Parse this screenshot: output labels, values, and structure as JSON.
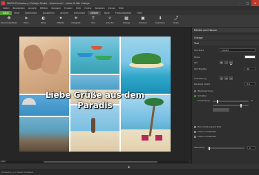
{
  "window": {
    "title": "MAGIX Photostory / Collage Studio - Unbenannt* - Liebe Grüße Collage"
  },
  "menu": [
    "Datei",
    "Bearbeiten",
    "Ansicht",
    "Effekte",
    "Vorlagen",
    "Fenster",
    "Hilfe",
    "Online",
    "Aktionen",
    "Extras",
    "Hilfe"
  ],
  "tabs": [
    "Datei",
    "Start",
    "Bearbeiten",
    "Auswählen",
    "Ansicht",
    "Hilfsmittel",
    "Effekte",
    "Texte",
    "Produktpalette",
    "Hilfe"
  ],
  "toolbar": [
    {
      "label": "Verschiebe/Photo",
      "icon": "move-icon"
    },
    {
      "label": "Maus",
      "icon": "cursor-icon"
    },
    {
      "label": "Farbe",
      "icon": "color-icon"
    },
    {
      "label": "Effekte",
      "icon": "effects-icon"
    },
    {
      "label": "Helligkeit",
      "icon": "brightness-icon"
    },
    {
      "label": "Text",
      "icon": "text-icon"
    },
    {
      "label": "Auto Fix",
      "icon": "autofix-icon"
    },
    {
      "label": "Collage",
      "icon": "collage-icon"
    },
    {
      "label": "Rahmen",
      "icon": "frame-icon"
    },
    {
      "label": "Speichern",
      "icon": "save-icon"
    },
    {
      "label": "Teilen",
      "icon": "share-icon"
    }
  ],
  "collage": {
    "line1": "Liebe Grüße aus dem",
    "line2": "Paradis"
  },
  "panel": {
    "header": "Effekte und Ebenen",
    "section1": "Collage",
    "section2": "Text",
    "font_label": "Schriftart",
    "font_value": "Impact",
    "color_label": "Farbe",
    "style_label": "Stil",
    "size_label": "Schriftgröße",
    "size_value": "30",
    "align_label": "Ausrichtung",
    "opacity_label": "Deckung (Gold)",
    "opacity_value": "0.0",
    "shadow_label": "Schatten",
    "soften_label": "Weichzeichnen",
    "outline_label": "Umrandung",
    "outline_value": "5",
    "check1": "Hervorhebung am Bild",
    "check2": "Linien und Kanten",
    "check3": "Linien und Kanten",
    "blur_label": "Weichheit",
    "blur_value": "0"
  },
  "status": {
    "zoom": "100%",
    "text": "Photostory (c) MAGIX Software"
  }
}
